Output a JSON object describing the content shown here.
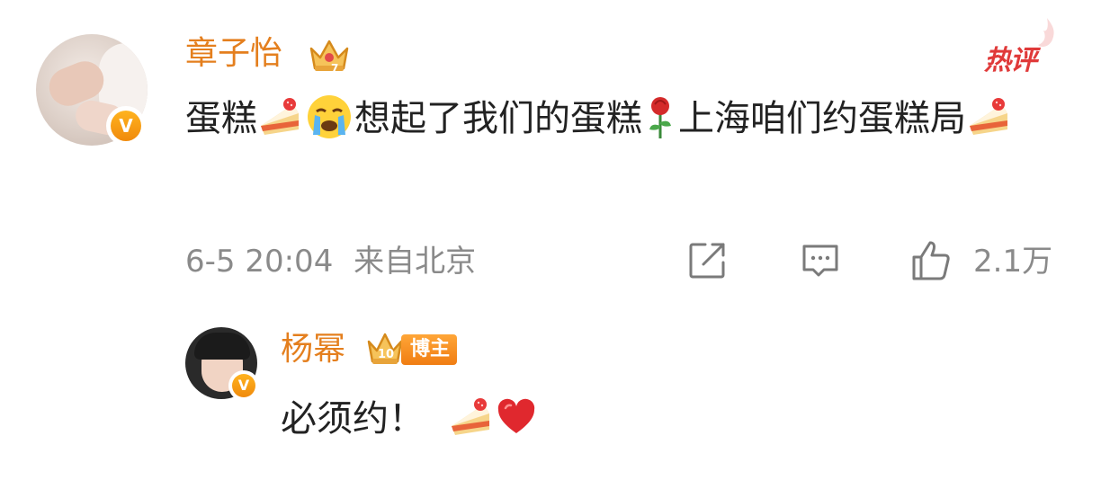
{
  "comment": {
    "author": "章子怡",
    "hot_tag": "热评",
    "text_1": "蛋糕",
    "text_2": "想起了我们的蛋糕",
    "text_3": "上海咱们约蛋糕局",
    "emojis": [
      "cake-emoji",
      "crying-face-emoji",
      "rose-emoji",
      "cake-emoji"
    ],
    "time": "6-5 20:04",
    "location": "来自北京",
    "like_count": "2.1万",
    "verified_badge": "V"
  },
  "reply": {
    "author": "杨幂",
    "author_badge": "博主",
    "text": "必须约！",
    "emojis": [
      "cake-emoji",
      "red-heart-emoji"
    ],
    "verified_badge": "V"
  },
  "colors": {
    "name": "#e47f1e",
    "text": "#222222",
    "meta": "#8a8a8a",
    "hot_tag": "#e03a3a",
    "badge": "#f08a0c"
  }
}
